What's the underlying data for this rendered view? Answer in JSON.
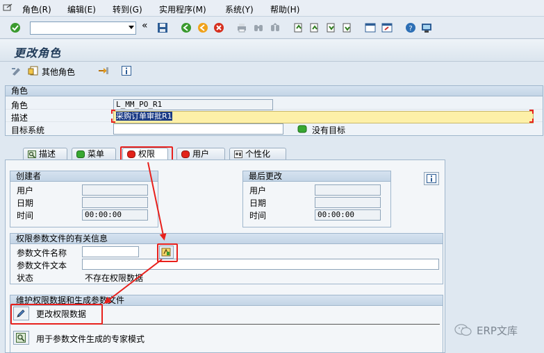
{
  "menu": {
    "items": [
      "角色(R)",
      "编辑(E)",
      "转到(G)",
      "实用程序(M)",
      "系统(Y)",
      "帮助(H)"
    ]
  },
  "toolbar": {
    "command_value": "",
    "icons": [
      "enter-check-icon",
      "save-icon",
      "back-icon",
      "exit-icon",
      "cancel-icon",
      "print-icon",
      "find-icon",
      "find-next-icon",
      "first-page-icon",
      "prev-page-icon",
      "next-page-icon",
      "last-page-icon",
      "new-session-icon",
      "shortcut-icon",
      "help-icon",
      "layout-icon"
    ]
  },
  "title": "更改角色",
  "appbar": {
    "other_roles": "其他角色"
  },
  "role_group": {
    "header": "角色",
    "role_label": "角色",
    "role_value": "L_MM_PO_R1",
    "desc_label": "描述",
    "desc_value": "采购订单审批R1",
    "target_label": "目标系统",
    "target_value": "",
    "no_target": "没有目标"
  },
  "tabs": [
    {
      "label": "描述",
      "icon": "magnifier-icon"
    },
    {
      "label": "菜单",
      "icon": "green-status-icon"
    },
    {
      "label": "权限",
      "icon": "red-status-icon"
    },
    {
      "label": "用户",
      "icon": "red-status-icon"
    },
    {
      "label": "个性化",
      "icon": "personalize-icon"
    }
  ],
  "creator": {
    "header": "创建者",
    "user_label": "用户",
    "date_label": "日期",
    "time_label": "时间",
    "time_value": "00:00:00"
  },
  "last_change": {
    "header": "最后更改",
    "user_label": "用户",
    "date_label": "日期",
    "time_label": "时间",
    "time_value": "00:00:00"
  },
  "profile_info": {
    "header": "权限参数文件的有关信息",
    "name_label": "参数文件名称",
    "name_value": "",
    "text_label": "参数文件文本",
    "text_value": "",
    "status_label": "状态",
    "status_value": "不存在权限数据"
  },
  "maintain": {
    "header": "维护权限数据和生成参数文件",
    "change_button": "更改权限数据",
    "expert_button": "用于参数文件生成的专家模式"
  },
  "watermark": "ERP文库",
  "colors": {
    "highlight_field": "#fdf0a8",
    "annotation_red": "#e8201c",
    "group_header": "#c9d9e9"
  }
}
